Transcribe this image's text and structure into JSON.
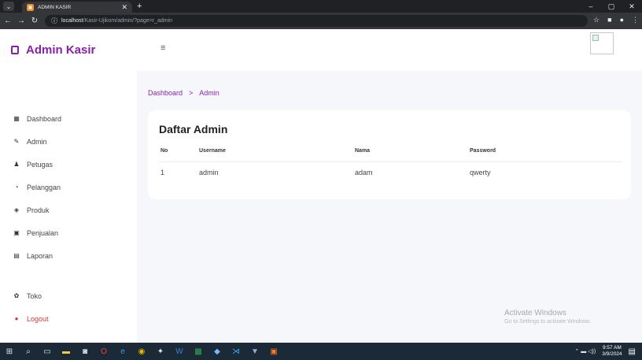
{
  "browser": {
    "tab_title": "ADMIN KASIR",
    "url_host": "localhost",
    "url_path": "/Kasir-Ujikom/admin/?page=r_admin",
    "window_controls": [
      "–",
      "▢",
      "✕"
    ]
  },
  "sidebar": {
    "brand": "Admin Kasir",
    "items": [
      {
        "icon": "dashboard-icon",
        "label": "Dashboard"
      },
      {
        "icon": "admin-icon",
        "label": "Admin"
      },
      {
        "icon": "petugas-icon",
        "label": "Petugas"
      },
      {
        "icon": "pelanggan-icon",
        "label": "Pelanggan"
      },
      {
        "icon": "produk-icon",
        "label": "Produk"
      },
      {
        "icon": "penjualan-icon",
        "label": "Penjualan"
      },
      {
        "icon": "laporan-icon",
        "label": "Laporan"
      }
    ],
    "bottom_items": [
      {
        "icon": "toko-icon",
        "label": "Toko"
      },
      {
        "icon": "logout-icon",
        "label": "Logout"
      }
    ]
  },
  "breadcrumb": {
    "home": "Dashboard",
    "separator": ">",
    "current": "Admin"
  },
  "card": {
    "title": "Daftar Admin",
    "columns": [
      "No",
      "Username",
      "Nama",
      "Password"
    ],
    "rows": [
      [
        "1",
        "admin",
        "adam",
        "qwerty"
      ]
    ]
  },
  "watermark": {
    "title": "Activate Windows",
    "subtitle": "Go to Settings to activate Windows."
  },
  "taskbar": {
    "time": "9:57 AM",
    "date": "3/9/2024"
  },
  "colors": {
    "accent": "#8a1fa8",
    "logout": "#e03131",
    "page_bg": "#f6f7fb"
  }
}
